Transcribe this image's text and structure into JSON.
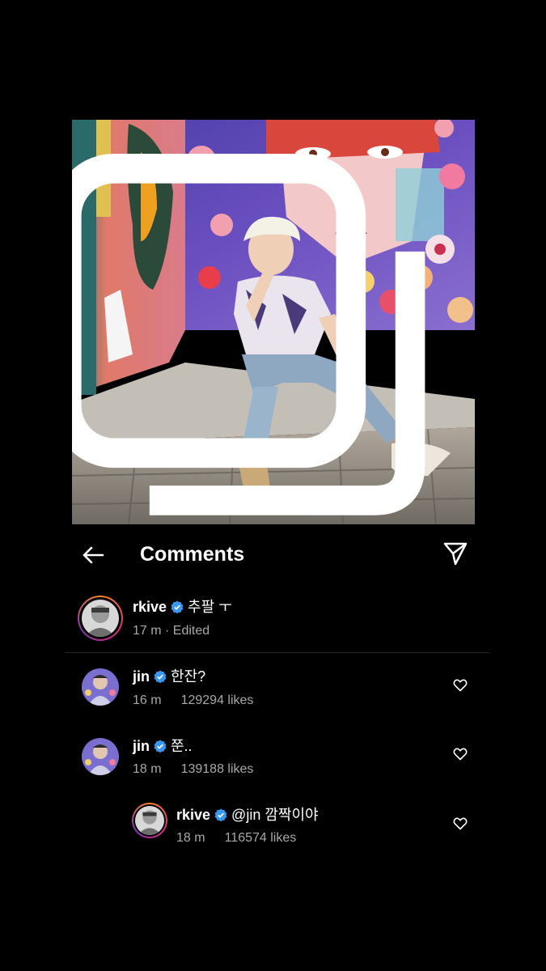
{
  "header": {
    "title": "Comments"
  },
  "caption": {
    "username": "rkive",
    "text": "추팔 ㅜ",
    "time": "17 m",
    "edited": "· Edited"
  },
  "comments": [
    {
      "username": "jin",
      "text": "한잔?",
      "time": "16 m",
      "likes": "129294 likes"
    },
    {
      "username": "jin",
      "text": "쭌..",
      "time": "18 m",
      "likes": "139188 likes"
    },
    {
      "username": "rkive",
      "text": "@jin 깜짝이야",
      "time": "18 m",
      "likes": "116574 likes"
    }
  ],
  "icons": {
    "back": "arrow-left-icon",
    "send": "paper-plane-icon",
    "like": "heart-outline-icon",
    "verified": "verified-badge-icon",
    "multi": "multiple-photos-icon"
  },
  "colors": {
    "verified": "#3897f0",
    "meta": "#a8a8a8",
    "background": "#000000"
  }
}
